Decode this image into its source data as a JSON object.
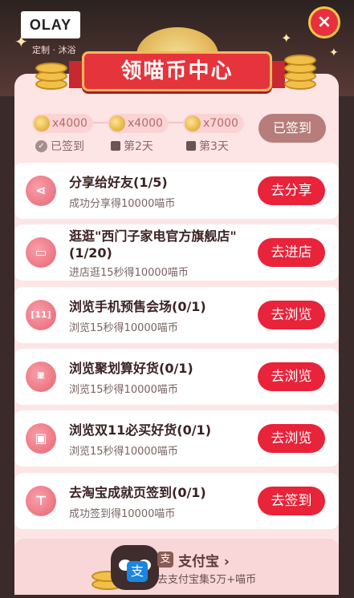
{
  "header": {
    "brand_logo": "OLAY",
    "brand_sub": "定制 · 沐浴",
    "close_icon": "×",
    "title": "领喵币中心"
  },
  "checkin": {
    "days": [
      {
        "coins": "x4000",
        "status_label": "已签到",
        "status_icon": "check-icon"
      },
      {
        "coins": "x4000",
        "status_label": "第2天",
        "status_icon": "lock-icon"
      },
      {
        "coins": "x7000",
        "status_label": "第3天",
        "status_icon": "lock-icon"
      }
    ],
    "button_label": "已签到"
  },
  "tasks": [
    {
      "title": "分享给好友(1/5)",
      "desc": "成功分享得10000喵币",
      "button": "去分享",
      "icon": "share-icon"
    },
    {
      "title": "逛逛\"西门子家电官方旗舰店\"(1/20)",
      "desc": "进店逛15秒得10000喵币",
      "button": "去进店",
      "icon": "store-icon"
    },
    {
      "title": "浏览手机预售会场(0/1)",
      "desc": "浏览15秒得10000喵币",
      "button": "去浏览",
      "icon": "phone-sale-icon"
    },
    {
      "title": "浏览聚划算好货(0/1)",
      "desc": "浏览15秒得10000喵币",
      "button": "去浏览",
      "icon": "juhuasuan-icon"
    },
    {
      "title": "浏览双11必买好货(0/1)",
      "desc": "浏览15秒得10000喵币",
      "button": "去浏览",
      "icon": "shopping-bag-icon"
    },
    {
      "title": "去淘宝成就页签到(0/1)",
      "desc": "成功签到得10000喵币",
      "button": "去签到",
      "icon": "shirt-icon"
    }
  ],
  "alipay": {
    "logo": "支",
    "name": "支付宝 ›",
    "desc": "去支付宝集5万+喵币"
  }
}
